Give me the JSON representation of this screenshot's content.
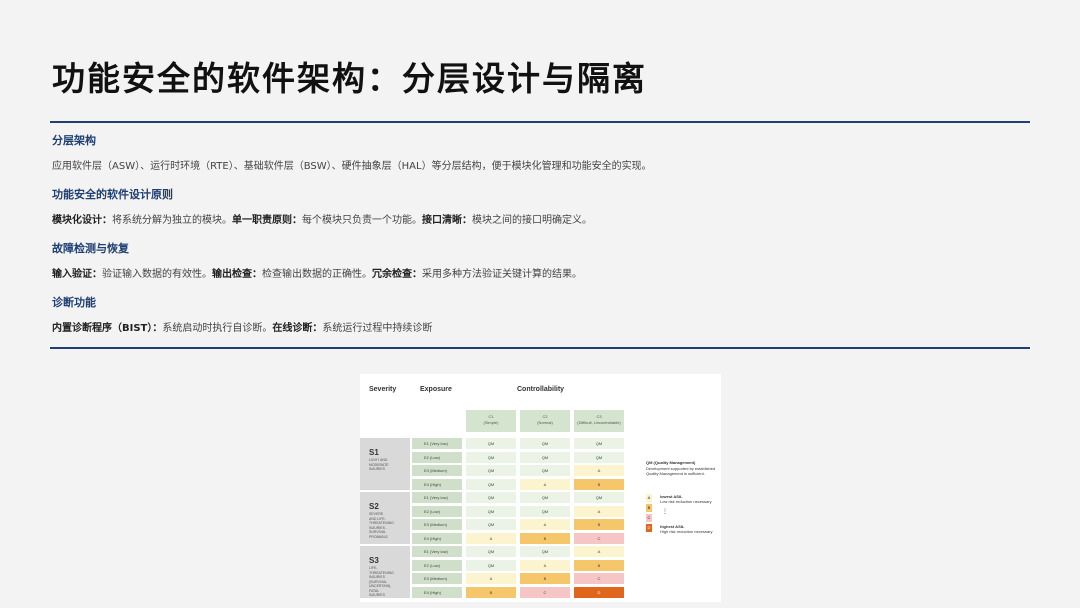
{
  "title": "功能安全的软件架构：分层设计与隔离",
  "sections": [
    {
      "heading": "分层架构",
      "body_plain": "应用软件层（ASW）、运行时环境（RTE）、基础软件层（BSW）、硬件抽象层（HAL）等分层结构，便于模块化管理和功能安全的实现。"
    },
    {
      "heading": "功能安全的软件设计原则",
      "parts": [
        {
          "label": "模块化设计：",
          "text": "将系统分解为独立的模块。"
        },
        {
          "label": "单一职责原则：",
          "text": "每个模块只负责一个功能。"
        },
        {
          "label": "接口清晰：",
          "text": "模块之间的接口明确定义。"
        }
      ]
    },
    {
      "heading": "故障检测与恢复",
      "parts": [
        {
          "label": "输入验证：",
          "text": "验证输入数据的有效性。"
        },
        {
          "label": "输出检查：",
          "text": "检查输出数据的正确性。"
        },
        {
          "label": "冗余检查：",
          "text": "采用多种方法验证关键计算的结果。"
        }
      ]
    },
    {
      "heading": "诊断功能",
      "parts": [
        {
          "label": "内置诊断程序（BIST）：",
          "text": "系统启动时执行自诊断。"
        },
        {
          "label": "在线诊断：",
          "text": "系统运行过程中持续诊断"
        }
      ]
    }
  ],
  "asil_table": {
    "headers": {
      "severity": "Severity",
      "exposure": "Exposure",
      "controllability": "Controllability"
    },
    "controllability": [
      {
        "code": "C1",
        "desc": "(Simple)"
      },
      {
        "code": "C2",
        "desc": "(Normal)"
      },
      {
        "code": "C3",
        "desc": "(Difficult, Uncontrollable)"
      }
    ],
    "severity": [
      {
        "code": "S1",
        "desc": "LIGHT AND\nMODERATE\nINJURIES"
      },
      {
        "code": "S2",
        "desc": "SEVERE\nAND LIFE-\nTHREATENING\nINJURIES -\nSURVIVAL\nPROBABLE"
      },
      {
        "code": "S3",
        "desc": "LIFE-\nTHREATENING\nINJURIES\n(SURVIVAL\nUNCERTAIN),\nFATAL\nINJURIES"
      }
    ],
    "exposure": [
      "E1 (Very low)",
      "E2 (Low)",
      "E3 (Medium)",
      "E4 (High)"
    ],
    "cells": [
      [
        [
          "QM",
          "QM",
          "QM"
        ],
        [
          "QM",
          "QM",
          "QM"
        ],
        [
          "QM",
          "QM",
          "A"
        ],
        [
          "QM",
          "A",
          "B"
        ]
      ],
      [
        [
          "QM",
          "QM",
          "QM"
        ],
        [
          "QM",
          "QM",
          "A"
        ],
        [
          "QM",
          "A",
          "B"
        ],
        [
          "A",
          "B",
          "C"
        ]
      ],
      [
        [
          "QM",
          "QM",
          "A"
        ],
        [
          "QM",
          "A",
          "B"
        ],
        [
          "A",
          "B",
          "C"
        ],
        [
          "B",
          "C",
          "D"
        ]
      ]
    ],
    "legend": {
      "qm_title": "QM (Quality Management)",
      "qm_text": "Development supported by established Quality Management is sufficient.",
      "levels": [
        "A",
        "B",
        "C",
        "D"
      ],
      "lowest_title": "lowest ASIL",
      "lowest_text": "Low risk reduction necessary",
      "dots": "⋮",
      "highest_title": "highest ASIL",
      "highest_text": "High risk reduction necessary"
    }
  }
}
